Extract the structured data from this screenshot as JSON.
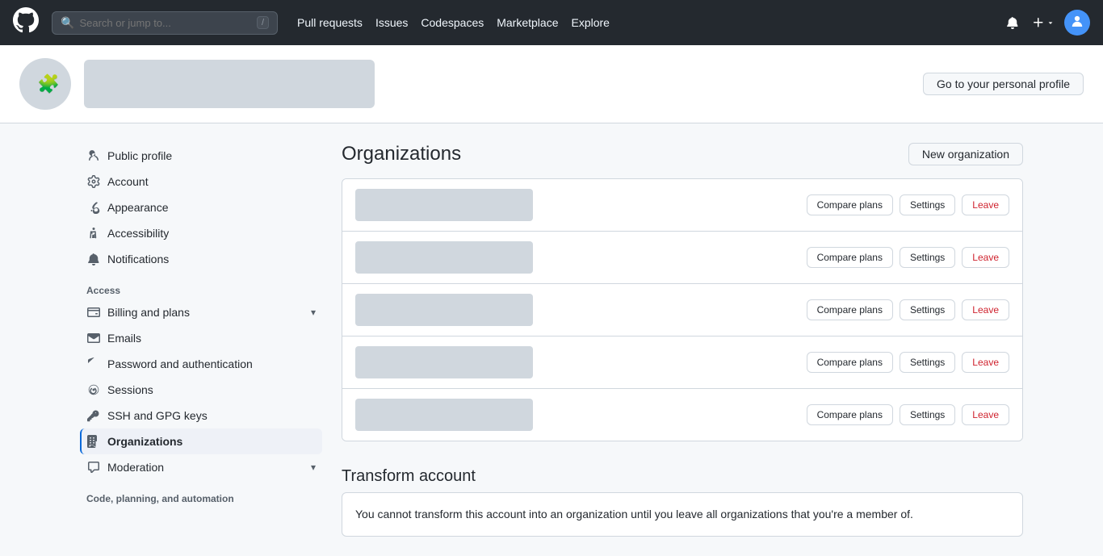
{
  "topnav": {
    "search_placeholder": "Search or jump to...",
    "kbd": "/",
    "links": [
      {
        "id": "pull-requests",
        "label": "Pull requests"
      },
      {
        "id": "issues",
        "label": "Issues"
      },
      {
        "id": "codespaces",
        "label": "Codespaces"
      },
      {
        "id": "marketplace",
        "label": "Marketplace"
      },
      {
        "id": "explore",
        "label": "Explore"
      }
    ],
    "go_to_profile_label": "Go to your personal profile"
  },
  "sidebar": {
    "items": [
      {
        "id": "public-profile",
        "label": "Public profile",
        "icon": "person"
      },
      {
        "id": "account",
        "label": "Account",
        "icon": "gear"
      },
      {
        "id": "appearance",
        "label": "Appearance",
        "icon": "paintbrush"
      },
      {
        "id": "accessibility",
        "label": "Accessibility",
        "icon": "accessibility"
      },
      {
        "id": "notifications",
        "label": "Notifications",
        "icon": "bell"
      }
    ],
    "access_label": "Access",
    "access_items": [
      {
        "id": "billing",
        "label": "Billing and plans",
        "icon": "credit-card",
        "has_chevron": true
      },
      {
        "id": "emails",
        "label": "Emails",
        "icon": "mail"
      },
      {
        "id": "password-auth",
        "label": "Password and authentication",
        "icon": "shield"
      },
      {
        "id": "sessions",
        "label": "Sessions",
        "icon": "broadcast"
      },
      {
        "id": "ssh-gpg",
        "label": "SSH and GPG keys",
        "icon": "key"
      },
      {
        "id": "organizations",
        "label": "Organizations",
        "icon": "organization",
        "active": true
      },
      {
        "id": "moderation",
        "label": "Moderation",
        "icon": "comment",
        "has_chevron": true
      }
    ],
    "code_planning_label": "Code, planning, and automation"
  },
  "content": {
    "page_title": "Organizations",
    "new_org_button": "New organization",
    "orgs": [
      {
        "id": "org1"
      },
      {
        "id": "org2"
      },
      {
        "id": "org3"
      },
      {
        "id": "org4"
      },
      {
        "id": "org5"
      }
    ],
    "org_row_buttons": {
      "compare_plans": "Compare plans",
      "settings": "Settings",
      "leave": "Leave"
    },
    "transform_title": "Transform account",
    "transform_text_part1": "You cannot transform this account into an organization until you leave all organizations that you're a member of."
  }
}
